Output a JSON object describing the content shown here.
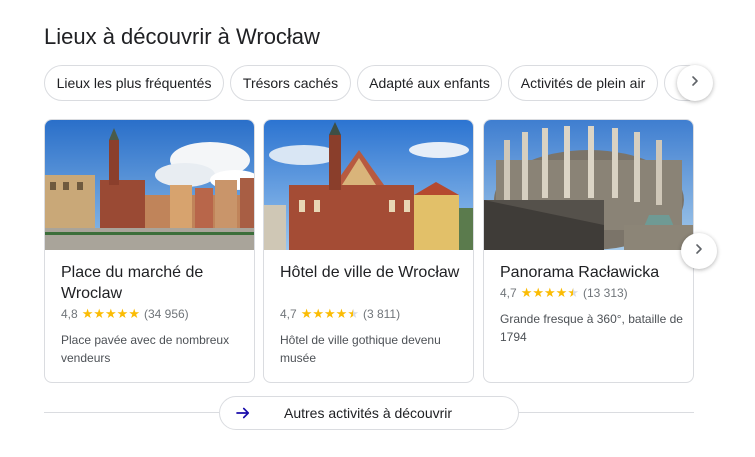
{
  "title": "Lieux à découvrir à Wrocław",
  "chips": [
    {
      "label": "Lieux les plus fréquentés"
    },
    {
      "label": "Trésors cachés"
    },
    {
      "label": "Adapté aux enfants"
    },
    {
      "label": "Activités de plein air"
    }
  ],
  "cards": [
    {
      "name": "Place du marché de Wroclaw",
      "rating": "4,8",
      "stars": 5,
      "reviews": "(34 956)",
      "description": "Place pavée avec de nombreux vendeurs",
      "image": "market-square-photo"
    },
    {
      "name": "Hôtel de ville de Wrocław",
      "rating": "4,7",
      "stars": 4.5,
      "reviews": "(3 811)",
      "description": "Hôtel de ville gothique devenu musée",
      "image": "town-hall-photo"
    },
    {
      "name": "Panorama Racławicka",
      "rating": "4,7",
      "stars": 4.5,
      "reviews": "(13 313)",
      "description": "Grande fresque à 360°, bataille de 1794",
      "image": "panorama-rotunda-photo"
    }
  ],
  "more_button": {
    "label": "Autres activités à découvrir",
    "icon": "arrow-right-icon"
  },
  "icons": {
    "chip_next": "chevron-right-icon",
    "card_next": "chevron-right-icon"
  },
  "colors": {
    "star": "#fbbc04",
    "border": "#dadce0",
    "text": "#202124",
    "muted": "#70757a",
    "arrow": "#1a0dab"
  }
}
